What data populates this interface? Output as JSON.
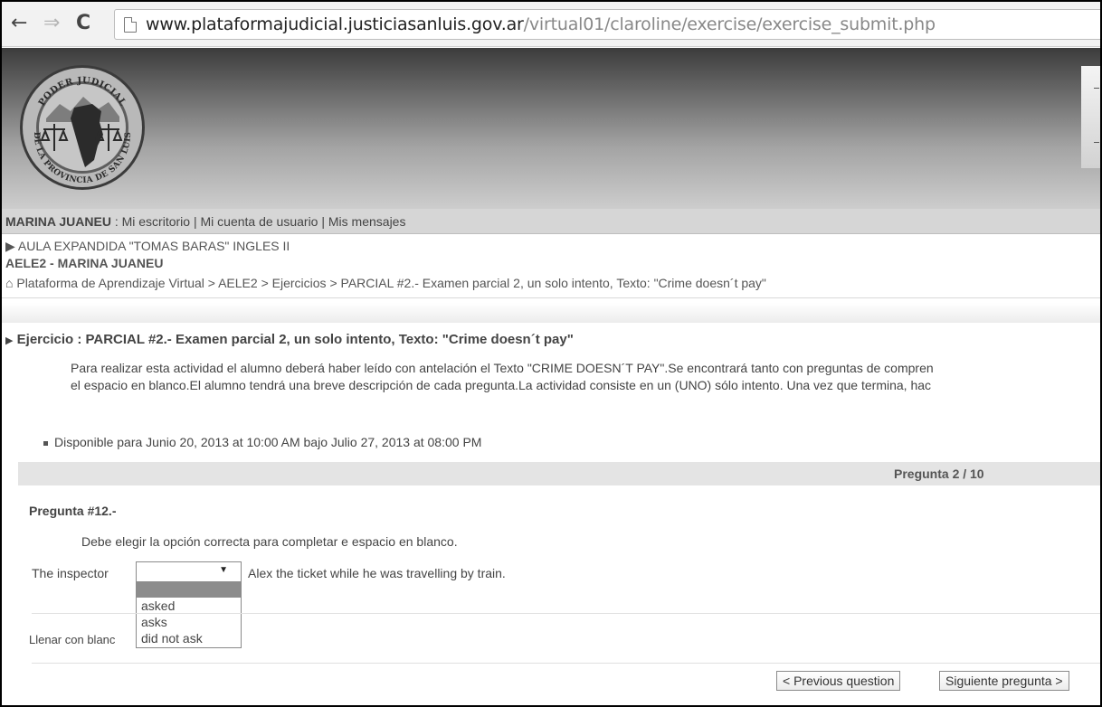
{
  "browser": {
    "url_host": "www.plataformajudicial.justiciasanluis.gov.ar",
    "url_path": "/virtual01/claroline/exercise/exercise_submit.php",
    "icons": [
      "back-icon",
      "forward-icon",
      "reload-icon",
      "page-icon"
    ]
  },
  "banner": {
    "logo_text_top": "PODER JUDICIAL",
    "logo_text_bottom": "DE LA PROVINCIA DE SAN LUIS"
  },
  "userbar": {
    "user": "MARINA JUANEU",
    "separator": " : ",
    "links": [
      "Mi escritorio",
      "Mi cuenta de usuario",
      "Mis mensajes"
    ]
  },
  "course": {
    "name": "AULA EXPANDIDA \"TOMAS BARAS\" INGLES II",
    "code": "AELE2 - MARINA JUANEU"
  },
  "breadcrumb": [
    "Plataforma de Aprendizaje Virtual",
    "AELE2",
    "Ejercicios",
    "PARCIAL #2.- Examen parcial 2, un solo intento, Texto: \"Crime doesn´t pay\""
  ],
  "exercise": {
    "title": "Ejercicio : PARCIAL #2.- Examen parcial 2, un solo intento, Texto: \"Crime doesn´t pay\"",
    "desc_line1": "Para realizar esta actividad el alumno deberá haber leído con antelación el Texto \"CRIME DOESN´T PAY\".Se encontrará tanto con preguntas de compren",
    "desc_line2": "el espacio en blanco.El alumno tendrá una breve descripción de cada pregunta.La actividad consiste en un (UNO) sólo intento.  Una vez que termina, hac",
    "availability": "Disponible para Junio 20, 2013 at 10:00 AM bajo Julio 27, 2013 at 08:00 PM"
  },
  "question": {
    "counter": "Pregunta 2 / 10",
    "number": "Pregunta #12.-",
    "description": "Debe elegir la opción correcta para completar e espacio en blanco.",
    "sentence_before": "The inspector",
    "sentence_after": "Alex the ticket while he was travelling by train.",
    "selected": "",
    "options": [
      "",
      "asked",
      "asks",
      "did not ask"
    ],
    "fill_blank_text": "Llenar con blanc"
  },
  "buttons": {
    "previous": "< Previous question",
    "next": "Siguiente pregunta >"
  }
}
